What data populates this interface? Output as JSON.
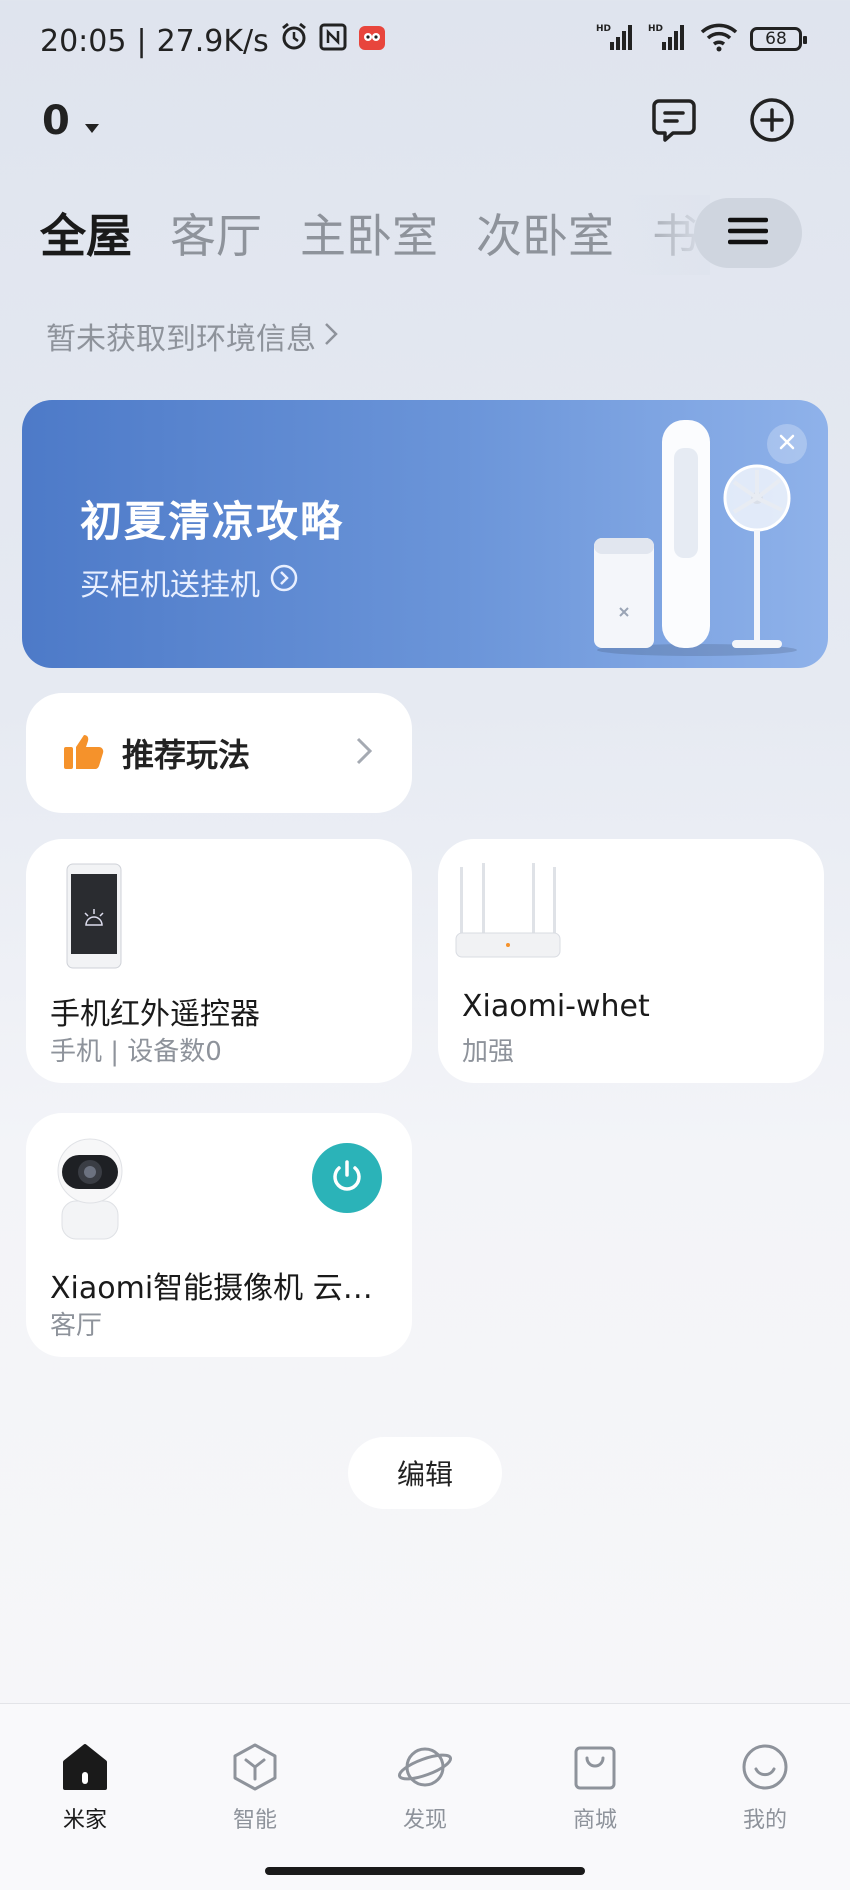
{
  "status_bar": {
    "time": "20:05",
    "separator": "|",
    "network_speed": "27.9K/s",
    "battery": "68",
    "signal_1_label": "HD",
    "signal_2_label": "HD",
    "icons": [
      "alarm-icon",
      "nfc-icon",
      "app-notification-icon",
      "signal-icon",
      "wifi-icon",
      "battery-icon"
    ]
  },
  "header": {
    "home_name": "0",
    "icons": [
      "message-icon",
      "add-icon"
    ]
  },
  "room_tabs": [
    "全屋",
    "客厅",
    "主卧室",
    "次卧室",
    "书"
  ],
  "environment_info": "暂未获取到环境信息",
  "banner": {
    "title": "初夏清凉攻略",
    "subtitle": "买柜机送挂机"
  },
  "recommend": {
    "label": "推荐玩法"
  },
  "devices": [
    {
      "name": "手机红外遥控器",
      "sub": "手机 | 设备数0",
      "icon": "phone-remote-icon"
    },
    {
      "name": "Xiaomi-whet",
      "sub": "加强",
      "icon": "router-icon"
    },
    {
      "name": "Xiaomi智能摄像机 云…",
      "sub": "客厅",
      "icon": "camera-icon",
      "power": true
    }
  ],
  "edit_label": "编辑",
  "bottom_nav": [
    {
      "label": "米家",
      "icon": "home-icon",
      "active": true
    },
    {
      "label": "智能",
      "icon": "smart-cube-icon",
      "active": false
    },
    {
      "label": "发现",
      "icon": "planet-icon",
      "active": false
    },
    {
      "label": "商城",
      "icon": "shopping-bag-icon",
      "active": false
    },
    {
      "label": "我的",
      "icon": "smile-icon",
      "active": false
    }
  ],
  "colors": {
    "accent_teal": "#2bb3b8",
    "banner_blue": "#4d7ac8",
    "thumb_orange": "#f5922b"
  }
}
